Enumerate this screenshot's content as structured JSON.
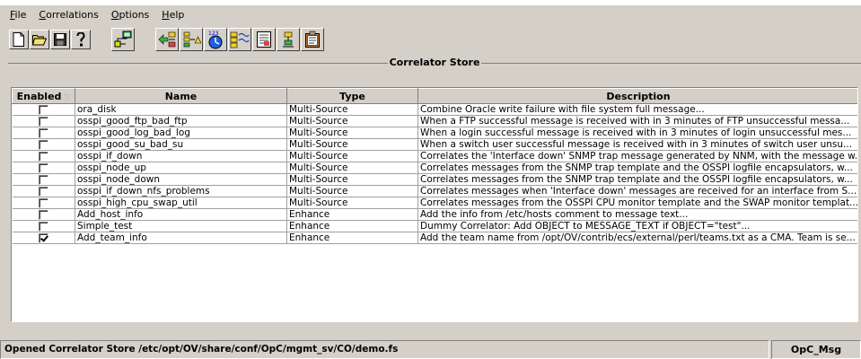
{
  "menu": {
    "items": [
      {
        "mnemonic": "F",
        "rest": "ile"
      },
      {
        "mnemonic": "C",
        "rest": "orrelations"
      },
      {
        "mnemonic": "O",
        "rest": "ptions"
      },
      {
        "mnemonic": "H",
        "rest": "elp"
      }
    ]
  },
  "toolbar": {
    "icons": [
      "new-document-icon",
      "open-folder-icon",
      "save-disk-icon",
      "help-question-icon",
      "network-icon",
      "correlation-multi-icon",
      "correlation-alert-icon",
      "timer-icon",
      "message-sequence-icon",
      "list-filter-icon",
      "enhance-icon",
      "properties-icon"
    ]
  },
  "store": {
    "title": "Correlator Store",
    "columns": {
      "enabled": "Enabled",
      "name": "Name",
      "type": "Type",
      "description": "Description"
    },
    "rows": [
      {
        "enabled": false,
        "name": "ora_disk",
        "type": "Multi-Source",
        "description": "Combine Oracle write failure with file system full message..."
      },
      {
        "enabled": false,
        "name": "osspi_good_ftp_bad_ftp",
        "type": "Multi-Source",
        "description": "When a FTP successful message is received with in 3 minutes of FTP unsuccessful messa..."
      },
      {
        "enabled": false,
        "name": "osspi_good_log_bad_log",
        "type": "Multi-Source",
        "description": "When a login successful message is received with in 3 minutes of login unsuccessful mes..."
      },
      {
        "enabled": false,
        "name": "osspi_good_su_bad_su",
        "type": "Multi-Source",
        "description": "When a switch user successful message is received with in 3 minutes of switch user unsu..."
      },
      {
        "enabled": false,
        "name": "osspi_if_down",
        "type": "Multi-Source",
        "description": "Correlates the 'Interface down' SNMP trap message generated by NNM, with the message w..."
      },
      {
        "enabled": false,
        "name": "osspi_node_up",
        "type": "Multi-Source",
        "description": "Correlates messages from the SNMP trap template and the OSSPI logfile encapsulators, w..."
      },
      {
        "enabled": false,
        "name": "osspi_node_down",
        "type": "Multi-Source",
        "description": "Correlates messages from the SNMP trap template and the OSSPI logfile encapsulators, w..."
      },
      {
        "enabled": false,
        "name": "osspi_if_down_nfs_problems",
        "type": "Multi-Source",
        "description": "Correlates messages when 'Interface down' messages are received for an interface from S..."
      },
      {
        "enabled": false,
        "name": "osspi_high_cpu_swap_util",
        "type": "Multi-Source",
        "description": "Correlates messages from the OSSPI CPU monitor template and the SWAP monitor templat..."
      },
      {
        "enabled": false,
        "name": "Add_host_info",
        "type": "Enhance",
        "description": "Add the info from /etc/hosts comment to message text..."
      },
      {
        "enabled": false,
        "name": "Simple_test",
        "type": "Enhance",
        "description": "Dummy Correlator: Add OBJECT to MESSAGE_TEXT if OBJECT=\"test\"..."
      },
      {
        "enabled": true,
        "name": "Add_team_info",
        "type": "Enhance",
        "description": "Add the team name from /opt/OV/contrib/ecs/external/perl/teams.txt as a CMA. Team is se..."
      }
    ]
  },
  "status": {
    "message": "Opened Correlator Store /etc/opt/OV/share/conf/OpC/mgmt_sv/CO/demo.fs",
    "right": "OpC_Msg"
  },
  "colors": {
    "window_bg": "#d4d0c8",
    "table_bg": "#ffffff"
  }
}
